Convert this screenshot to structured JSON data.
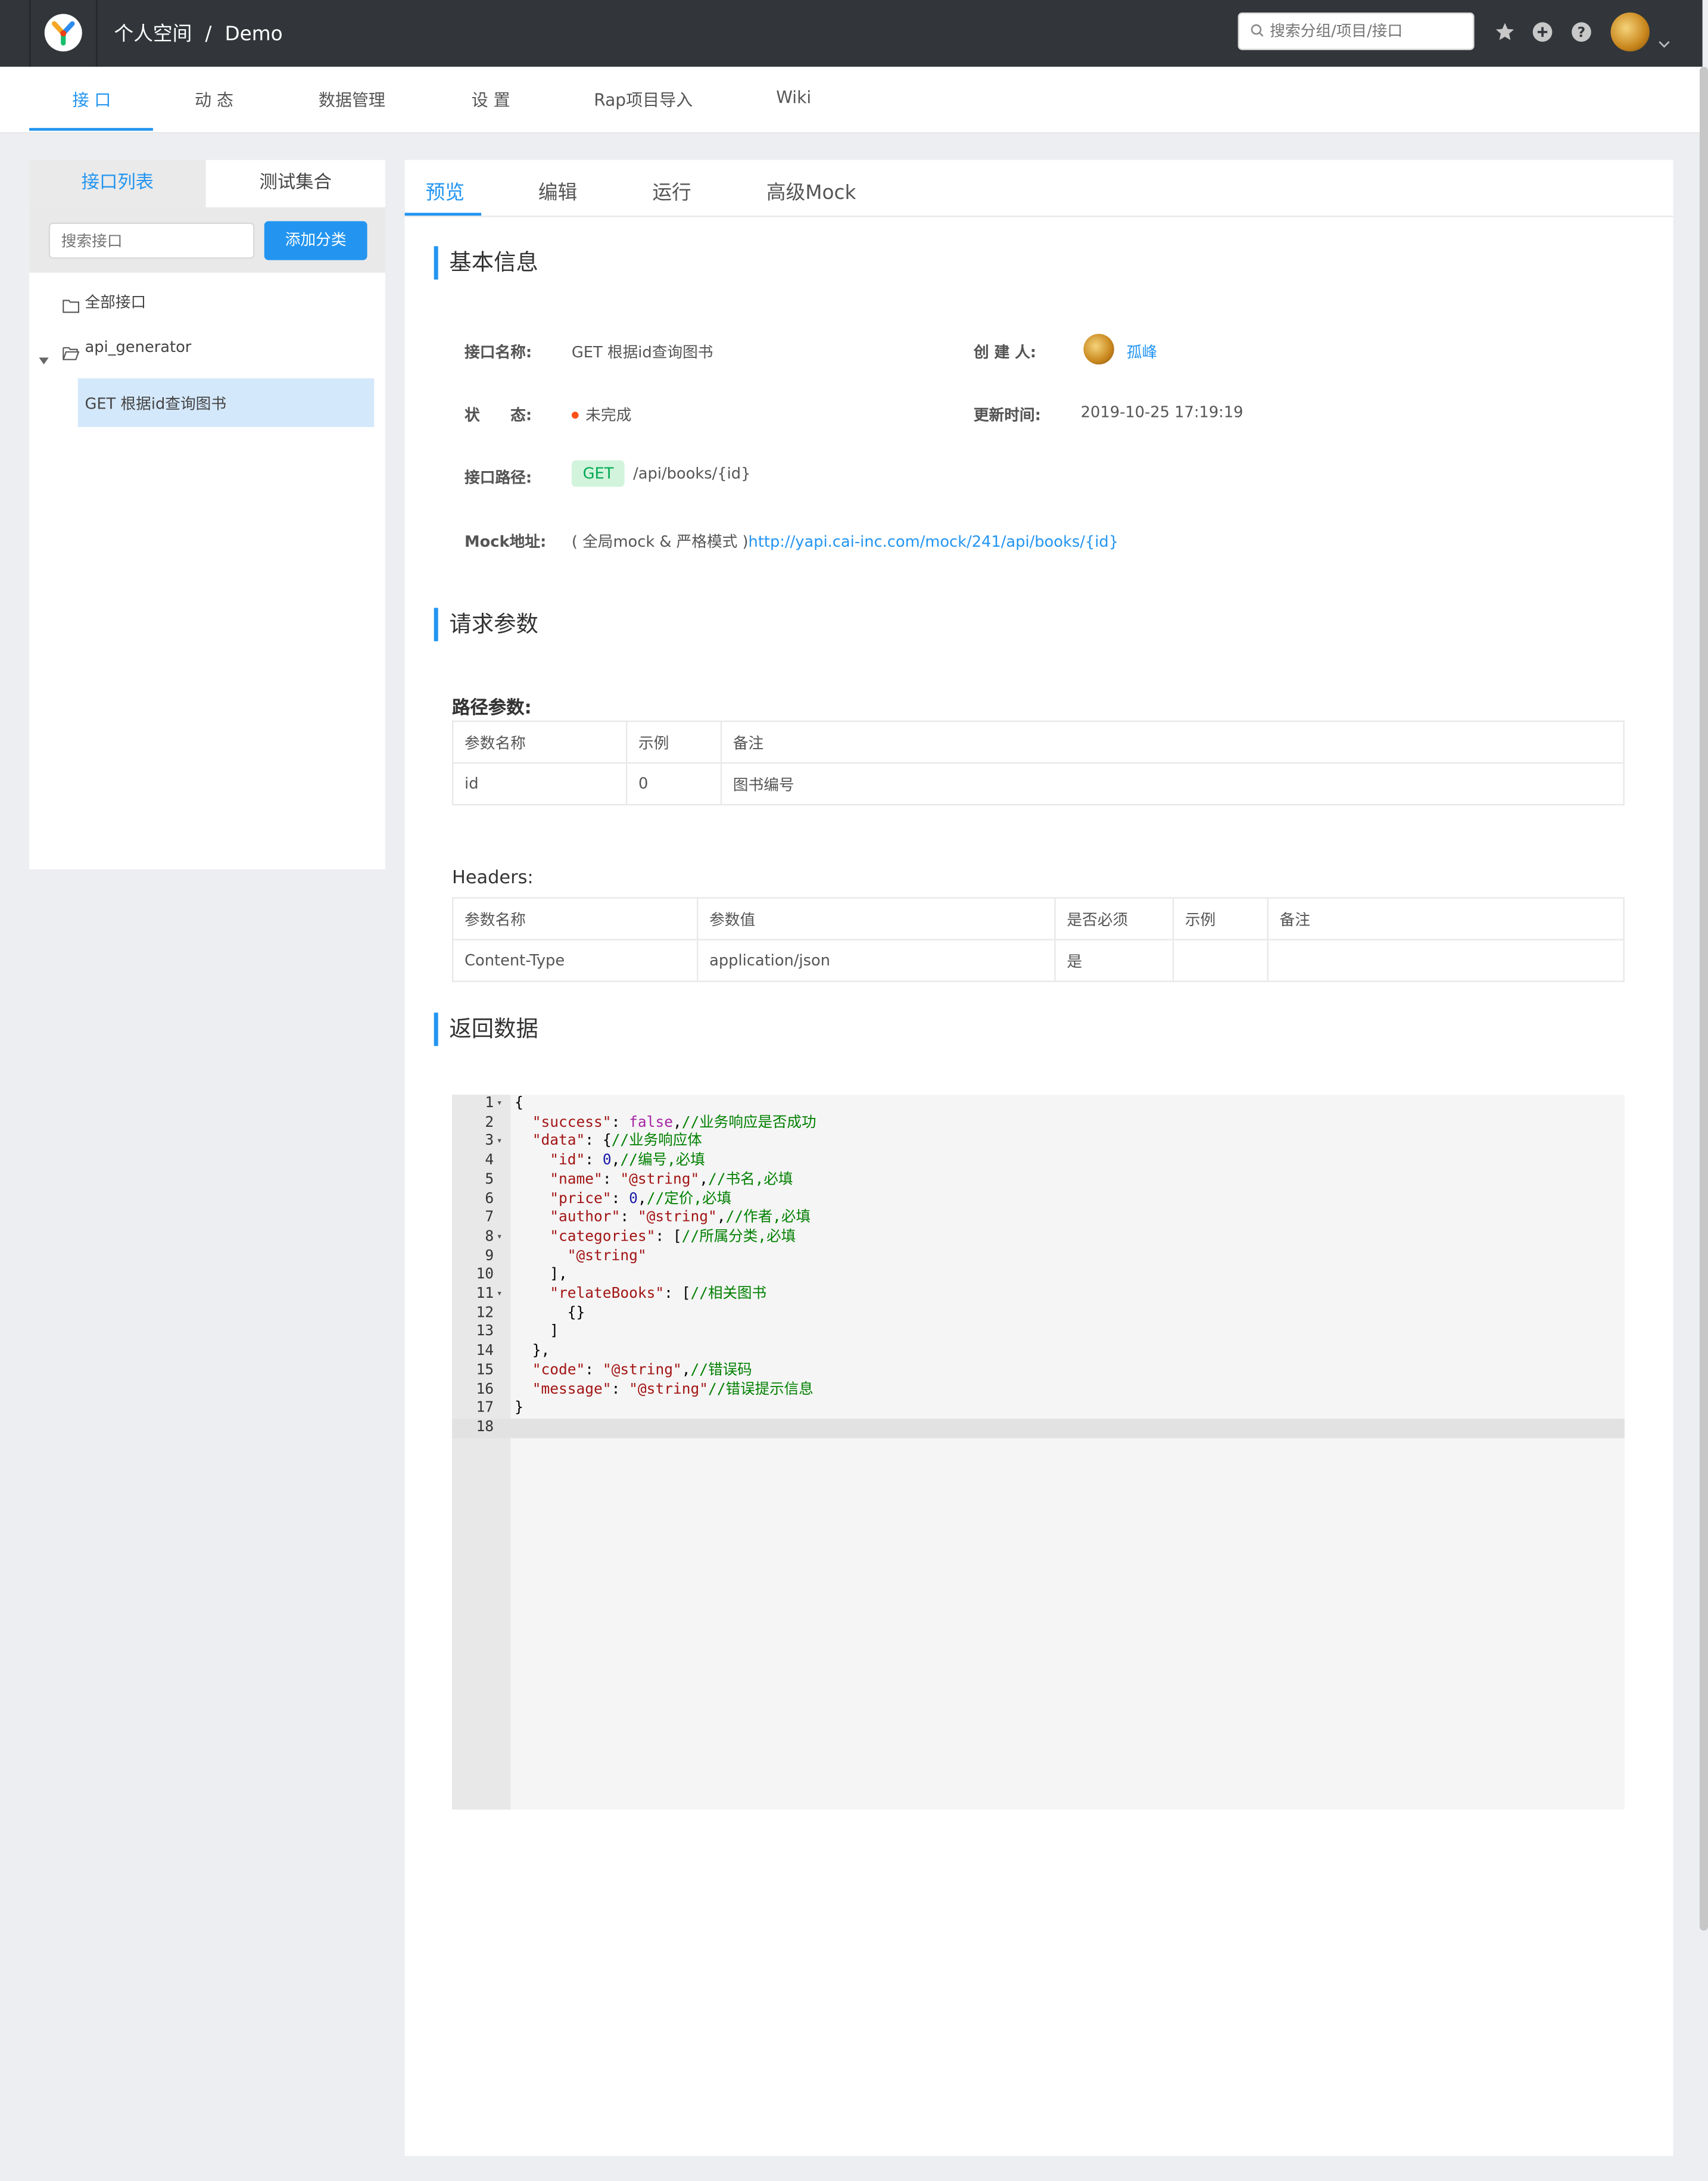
{
  "topbar": {
    "breadcrumb_group": "个人空间",
    "breadcrumb_sep": "/",
    "breadcrumb_project": "Demo",
    "search_placeholder": "搜索分组/项目/接口",
    "icons": [
      "logo-icon",
      "star-icon",
      "plus-circle-icon",
      "help-icon",
      "avatar",
      "chevron-down-icon"
    ]
  },
  "subnav": {
    "items": [
      "接 口",
      "动 态",
      "数据管理",
      "设 置",
      "Rap项目导入",
      "Wiki"
    ],
    "active": "接 口"
  },
  "left": {
    "tabs": [
      "接口列表",
      "测试集合"
    ],
    "active_tab": "接口列表",
    "search_placeholder": "搜索接口",
    "add_button": "添加分类",
    "tree": {
      "all": "全部接口",
      "category": "api_generator",
      "item": "GET 根据id查询图书"
    }
  },
  "main": {
    "tabs": [
      "预览",
      "编辑",
      "运行",
      "高级Mock"
    ],
    "active_tab": "预览",
    "basic_title": "基本信息",
    "name_label": "接口名称:",
    "name_value": "GET 根据id查询图书",
    "creator_label": "创 建 人:",
    "creator_value": "孤峰",
    "status_label": "状　　态:",
    "status_value": "未完成",
    "updated_label": "更新时间:",
    "updated_value": "2019-10-25 17:19:19",
    "path_label": "接口路径:",
    "method": "GET",
    "path_value": "/api/books/{id}",
    "mock_label": "Mock地址:",
    "mock_prefix": "( 全局mock & 严格模式 )",
    "mock_url": "http://yapi.cai-inc.com/mock/241/api/books/{id}",
    "request_title": "请求参数",
    "path_params_title": "路径参数:",
    "path_params": {
      "headers": [
        "参数名称",
        "示例",
        "备注"
      ],
      "rows": [
        [
          "id",
          "0",
          "图书编号"
        ]
      ]
    },
    "headers_title": "Headers:",
    "headers_table": {
      "headers": [
        "参数名称",
        "参数值",
        "是否必须",
        "示例",
        "备注"
      ],
      "rows": [
        [
          "Content-Type",
          "application/json",
          "是",
          "",
          ""
        ]
      ]
    },
    "response_title": "返回数据",
    "code_lines": [
      {
        "n": "1",
        "fold": true
      },
      {
        "n": "2",
        "fold": false
      },
      {
        "n": "3",
        "fold": true
      },
      {
        "n": "4",
        "fold": false
      },
      {
        "n": "5",
        "fold": false
      },
      {
        "n": "6",
        "fold": false
      },
      {
        "n": "7",
        "fold": false
      },
      {
        "n": "8",
        "fold": true
      },
      {
        "n": "9",
        "fold": false
      },
      {
        "n": "10",
        "fold": false
      },
      {
        "n": "11",
        "fold": true
      },
      {
        "n": "12",
        "fold": false
      },
      {
        "n": "13",
        "fold": false
      },
      {
        "n": "14",
        "fold": false
      },
      {
        "n": "15",
        "fold": false
      },
      {
        "n": "16",
        "fold": false
      },
      {
        "n": "17",
        "fold": false
      },
      {
        "n": "18",
        "fold": false
      }
    ],
    "code": {
      "l1": "{",
      "l2_key": "\"success\"",
      "l2_val": "false",
      "l2_comment": "//业务响应是否成功",
      "l3_key": "\"data\"",
      "l3_comment": "//业务响应体",
      "l4_key": "\"id\"",
      "l4_val": "0",
      "l4_comment": "//编号,必填",
      "l5_key": "\"name\"",
      "l5_val": "\"@string\"",
      "l5_comment": "//书名,必填",
      "l6_key": "\"price\"",
      "l6_val": "0",
      "l6_comment": "//定价,必填",
      "l7_key": "\"author\"",
      "l7_val": "\"@string\"",
      "l7_comment": "//作者,必填",
      "l8_key": "\"categories\"",
      "l8_comment": "//所属分类,必填",
      "l9_val": "\"@string\"",
      "l10": "],",
      "l11_key": "\"relateBooks\"",
      "l11_comment": "//相关图书",
      "l12": "{}",
      "l13": "]",
      "l14": "},",
      "l15_key": "\"code\"",
      "l15_val": "\"@string\"",
      "l15_comment": "//错误码",
      "l16_key": "\"message\"",
      "l16_val": "\"@string\"",
      "l16_comment": "//错误提示信息",
      "l17": "}"
    }
  },
  "colors": {
    "topbar": "#32363a",
    "accent": "#2395f1",
    "get_tag_bg": "#d2f4dc",
    "get_tag_text": "#00a854",
    "status_dot": "#fd4f1a"
  }
}
